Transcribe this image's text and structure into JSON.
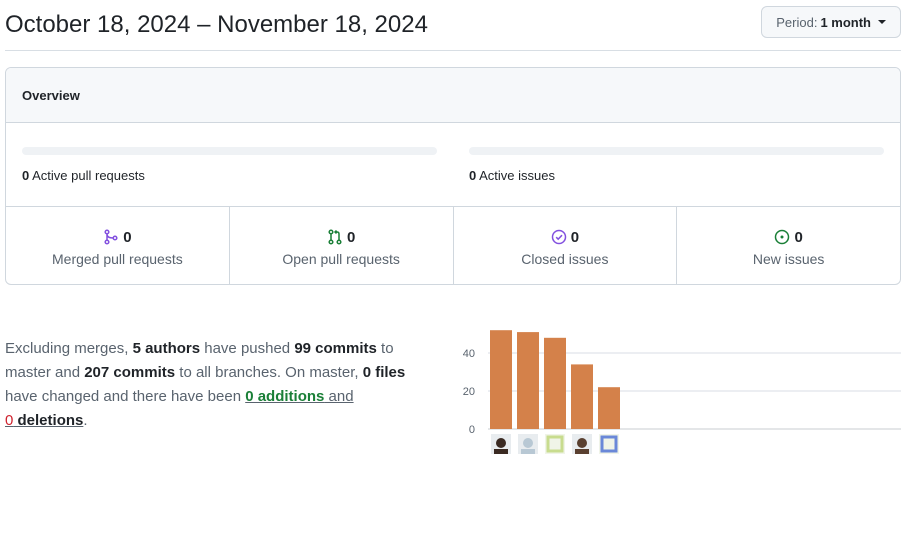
{
  "header": {
    "date_range": "October 18, 2024 – November 18, 2024",
    "period_label": "Period:",
    "period_value": "1 month"
  },
  "overview": {
    "title": "Overview",
    "active_prs": {
      "count": "0",
      "label": "Active pull requests",
      "fill_fraction": 0
    },
    "active_issues": {
      "count": "0",
      "label": "Active issues",
      "fill_fraction": 0
    },
    "stats": [
      {
        "count": "0",
        "label": "Merged pull requests",
        "icon": "git-merge-icon",
        "color": "#8250df"
      },
      {
        "count": "0",
        "label": "Open pull requests",
        "icon": "git-pull-request-icon",
        "color": "#1a7f37"
      },
      {
        "count": "0",
        "label": "Closed issues",
        "icon": "issue-closed-icon",
        "color": "#8250df"
      },
      {
        "count": "0",
        "label": "New issues",
        "icon": "issue-opened-icon",
        "color": "#1a7f37"
      }
    ]
  },
  "summary": {
    "p1": "Excluding merges, ",
    "authors": "5 authors",
    "p2": " have pushed ",
    "commits_master": "99 commits",
    "p3": " to master and ",
    "commits_all": "207 commits",
    "p4": " to all branches. On master, ",
    "files": "0 files",
    "p5": " have changed and there have been ",
    "additions": "0 additions",
    "p6": " and",
    "deletions_num": "0",
    "deletions_word": " deletions",
    "p7": "."
  },
  "chart_data": {
    "type": "bar",
    "categories": [
      "author-1",
      "author-2",
      "author-3",
      "author-4",
      "author-5"
    ],
    "values": [
      52,
      51,
      48,
      34,
      22
    ],
    "yticks": [
      "0",
      "20",
      "40"
    ],
    "ylim": [
      0,
      60
    ],
    "bar_color": "#d4814a",
    "grid": true
  }
}
